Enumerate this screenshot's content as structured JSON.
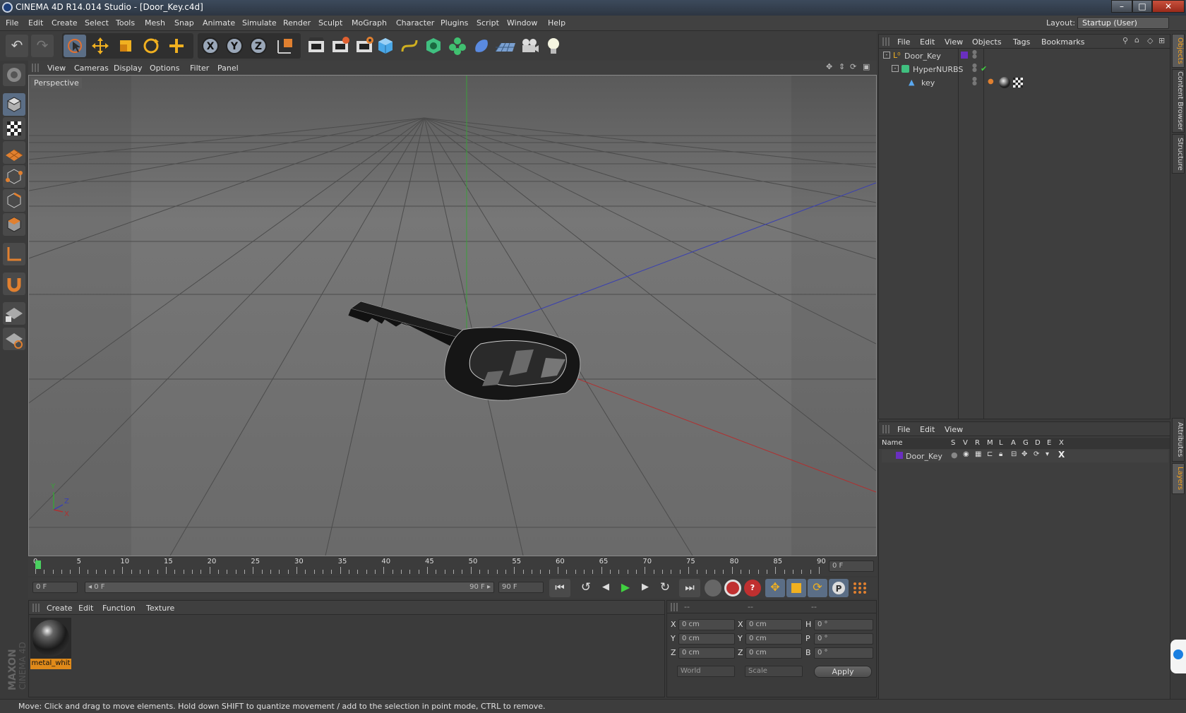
{
  "window": {
    "title": "CINEMA 4D R14.014 Studio - [Door_Key.c4d]",
    "min": "–",
    "max": "□",
    "close": "✕"
  },
  "menu": [
    "File",
    "Edit",
    "Create",
    "Select",
    "Tools",
    "Mesh",
    "Snap",
    "Animate",
    "Simulate",
    "Render",
    "Sculpt",
    "MoGraph",
    "Character",
    "Plugins",
    "Script",
    "Window",
    "Help"
  ],
  "layout": {
    "label": "Layout:",
    "value": "Startup (User)"
  },
  "viewport": {
    "menu": [
      "View",
      "Cameras",
      "Display",
      "Options",
      "Filter",
      "Panel"
    ],
    "label": "Perspective",
    "axis_y": "Y",
    "axis_z": "Z",
    "axis_x": "X"
  },
  "timeline": {
    "ticks": [
      "0",
      "5",
      "10",
      "15",
      "20",
      "25",
      "30",
      "35",
      "40",
      "45",
      "50",
      "55",
      "60",
      "65",
      "70",
      "75",
      "80",
      "85",
      "90"
    ],
    "current_frame": "0 F"
  },
  "transport": {
    "start": "0 F",
    "range_start": "◂ 0 F",
    "range_end": "90 F ▸",
    "end": "90 F"
  },
  "material_panel": {
    "menu": [
      "Create",
      "Edit",
      "Function",
      "Texture"
    ],
    "material_name": "metal_whit"
  },
  "coord_panel": {
    "headers": [
      "--",
      "--",
      "--"
    ],
    "rows": [
      {
        "a": "X",
        "av": "0 cm",
        "b": "X",
        "bv": "0 cm",
        "c": "H",
        "cv": "0 °"
      },
      {
        "a": "Y",
        "av": "0 cm",
        "b": "Y",
        "bv": "0 cm",
        "c": "P",
        "cv": "0 °"
      },
      {
        "a": "Z",
        "av": "0 cm",
        "b": "Z",
        "bv": "0 cm",
        "c": "B",
        "cv": "0 °"
      }
    ],
    "space": "World",
    "mode": "Scale",
    "apply": "Apply"
  },
  "object_panel": {
    "menu": [
      "File",
      "Edit",
      "View",
      "Objects",
      "Tags",
      "Bookmarks"
    ],
    "objects": [
      {
        "name": "Door_Key",
        "indent": 0
      },
      {
        "name": "HyperNURBS",
        "indent": 1
      },
      {
        "name": "key",
        "indent": 2
      }
    ]
  },
  "layer_panel": {
    "menu": [
      "File",
      "Edit",
      "View"
    ],
    "columns": [
      "Name",
      "S",
      "V",
      "R",
      "M",
      "L",
      "A",
      "G",
      "D",
      "E",
      "X"
    ],
    "layers": [
      {
        "name": "Door_Key",
        "color": "#6a2fc0"
      }
    ]
  },
  "right_tabs": [
    "Objects",
    "Content Browser",
    "Structure",
    "Attributes",
    "Layers"
  ],
  "status": "Move: Click and drag to move elements. Hold down SHIFT to quantize movement / add to the selection in point mode, CTRL to remove.",
  "brand": {
    "maxon": "MAXON",
    "product": "CINEMA 4D"
  },
  "colors": {
    "accent": "#5b6e86",
    "layer": "#6a2fc0",
    "x_axis": "#b03030",
    "y_axis": "#30a030",
    "z_axis": "#3040b0"
  }
}
